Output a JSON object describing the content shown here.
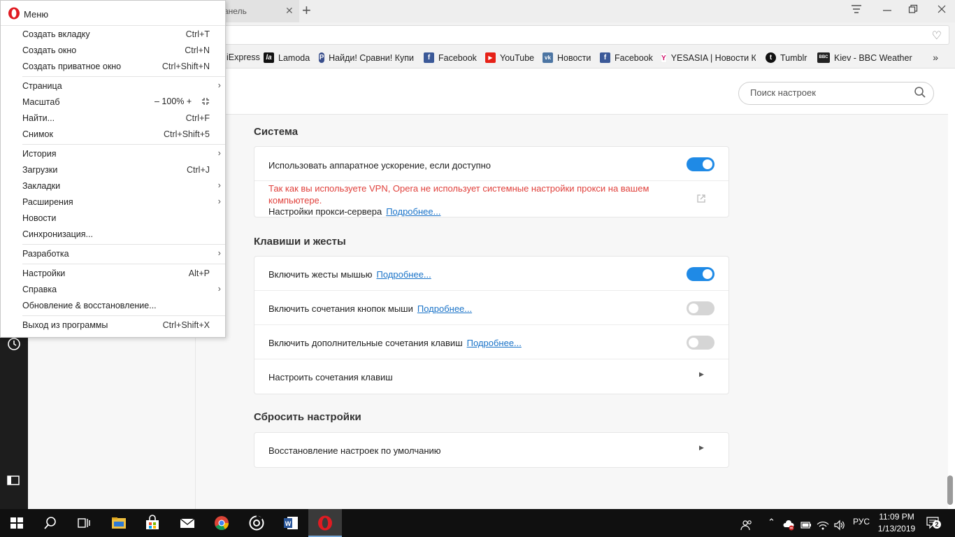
{
  "browser": {
    "tab_title": "анель",
    "tab_close": "✕",
    "tab_add": "+",
    "bookmarks": [
      {
        "label": "iExpress",
        "icon": "aliexpress-icon"
      },
      {
        "label": "Lamoda",
        "icon": "lamoda-icon",
        "glyph": "la"
      },
      {
        "label": "Найди! Сравни! Купи",
        "icon": "price-compare-icon",
        "glyph": "P"
      },
      {
        "label": "Facebook",
        "icon": "facebook-icon",
        "glyph": "f"
      },
      {
        "label": "YouTube",
        "icon": "youtube-icon",
        "glyph": "▶"
      },
      {
        "label": "Новости",
        "icon": "vk-icon",
        "glyph": "vk"
      },
      {
        "label": "Facebook",
        "icon": "facebook-icon",
        "glyph": "f"
      },
      {
        "label": "YESASIA | Новости К",
        "icon": "yesasia-icon",
        "glyph": "Y"
      },
      {
        "label": "Tumblr",
        "icon": "tumblr-icon",
        "glyph": "t"
      },
      {
        "label": "Kiev - BBC Weather",
        "icon": "bbc-icon",
        "glyph": "BBC"
      }
    ],
    "bookmarks_more": "»"
  },
  "menu": {
    "title": "Меню",
    "items": [
      {
        "label": "Создать вкладку",
        "shortcut": "Ctrl+T"
      },
      {
        "label": "Создать окно",
        "shortcut": "Ctrl+N"
      },
      {
        "label": "Создать приватное окно",
        "shortcut": "Ctrl+Shift+N"
      },
      {
        "label": "Страница",
        "submenu": true
      },
      {
        "label": "Масштаб",
        "zoom": "–  100%  +"
      },
      {
        "label": "Найти...",
        "shortcut": "Ctrl+F"
      },
      {
        "label": "Снимок",
        "shortcut": "Ctrl+Shift+5"
      },
      {
        "label": "История",
        "submenu": true
      },
      {
        "label": "Загрузки",
        "shortcut": "Ctrl+J"
      },
      {
        "label": "Закладки",
        "submenu": true
      },
      {
        "label": "Расширения",
        "submenu": true
      },
      {
        "label": "Новости"
      },
      {
        "label": "Синхронизация..."
      },
      {
        "label": "Разработка",
        "submenu": true
      },
      {
        "label": "Настройки",
        "shortcut": "Alt+P"
      },
      {
        "label": "Справка",
        "submenu": true
      },
      {
        "label": "Обновление & восстановление..."
      },
      {
        "label": "Выход из программы",
        "shortcut": "Ctrl+Shift+X"
      }
    ]
  },
  "settings": {
    "search_placeholder": "Поиск настроек",
    "system": {
      "title": "Система",
      "hw_accel": "Использовать аппаратное ускорение, если доступно",
      "hw_accel_on": true,
      "vpn_warning": "Так как вы используете VPN, Opera не использует системные настройки прокси на вашем компьютере.",
      "proxy_label": "Настройки прокси-сервера",
      "proxy_link": "Подробнее..."
    },
    "keys": {
      "title": "Клавиши и жесты",
      "rows": [
        {
          "label": "Включить жесты мышью",
          "link": "Подробнее...",
          "on": true
        },
        {
          "label": "Включить сочетания кнопок мыши",
          "link": "Подробнее...",
          "on": false
        },
        {
          "label": "Включить дополнительные сочетания клавиш",
          "link": "Подробнее...",
          "on": false
        }
      ],
      "configure": "Настроить сочетания клавиш"
    },
    "reset": {
      "title": "Сбросить настройки",
      "restore": "Восстановление настроек по умолчанию"
    }
  },
  "taskbar": {
    "language": "РУС",
    "time": "11:09 PM",
    "date": "1/13/2019",
    "notifications": "2"
  },
  "colors": {
    "accent": "#1f8ae6",
    "warning": "#e0413c",
    "opera_red": "#e01b22"
  }
}
